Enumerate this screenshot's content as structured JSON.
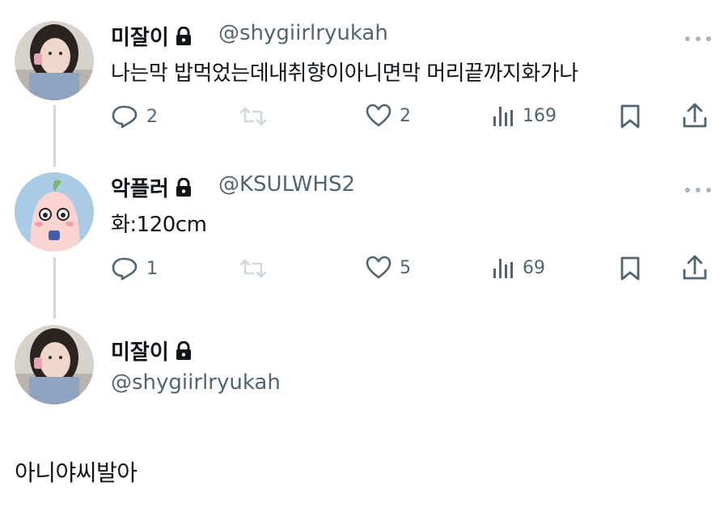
{
  "tweets": [
    {
      "display_name": "미잘이",
      "handle": "@shygiirlryukah",
      "text": "나는막  밥먹었는데내취향이아니면막 머리끝까지화가나",
      "replies": "2",
      "likes": "2",
      "views": "169"
    },
    {
      "display_name": "악플러",
      "handle": "@KSULWHS2",
      "text": "화:120cm",
      "replies": "1",
      "likes": "5",
      "views": "69"
    }
  ],
  "focused": {
    "display_name": "미잘이",
    "handle": "@shygiirlryukah",
    "text": "아니야씨발아"
  },
  "colors": {
    "text": "#0f1419",
    "muted": "#536471",
    "thread_line": "#cfd9de"
  },
  "icons": [
    "lock-icon",
    "reply-icon",
    "retweet-icon",
    "like-icon",
    "views-icon",
    "bookmark-icon",
    "share-icon",
    "more-icon"
  ]
}
